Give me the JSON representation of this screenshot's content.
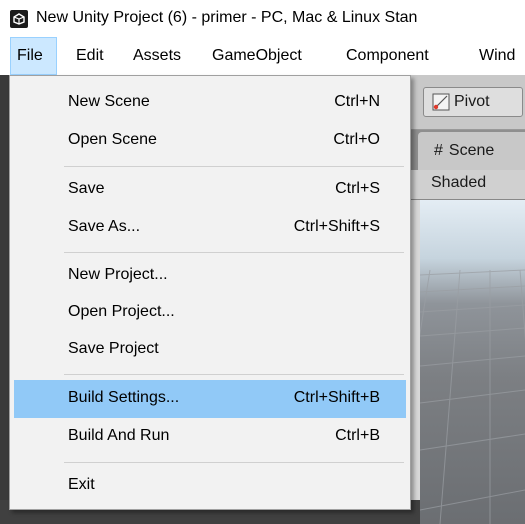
{
  "window": {
    "title": "New Unity Project (6) - primer - PC, Mac & Linux Stan",
    "icon": "unity-logo-icon"
  },
  "menubar": {
    "items": [
      {
        "label": "File",
        "active": true
      },
      {
        "label": "Edit"
      },
      {
        "label": "Assets"
      },
      {
        "label": "GameObject"
      },
      {
        "label": "Component"
      },
      {
        "label": "Wind"
      }
    ]
  },
  "file_menu": {
    "items": [
      {
        "label": "New Scene",
        "shortcut": "Ctrl+N"
      },
      {
        "label": "Open Scene",
        "shortcut": "Ctrl+O"
      },
      {
        "label": "Save",
        "shortcut": "Ctrl+S"
      },
      {
        "label": "Save As...",
        "shortcut": "Ctrl+Shift+S"
      },
      {
        "label": "New Project...",
        "shortcut": ""
      },
      {
        "label": "Open Project...",
        "shortcut": ""
      },
      {
        "label": "Save Project",
        "shortcut": ""
      },
      {
        "label": "Build Settings...",
        "shortcut": "Ctrl+Shift+B",
        "highlighted": true
      },
      {
        "label": "Build And Run",
        "shortcut": "Ctrl+B"
      },
      {
        "label": "Exit",
        "shortcut": ""
      }
    ]
  },
  "editor": {
    "pivot_label": "Pivot",
    "scene_tab_label": "Scene",
    "shading_mode": "Shaded"
  },
  "colors": {
    "highlight": "#91c9f7",
    "menu_active": "#cce8ff",
    "menu_background": "#f2f2f2"
  }
}
